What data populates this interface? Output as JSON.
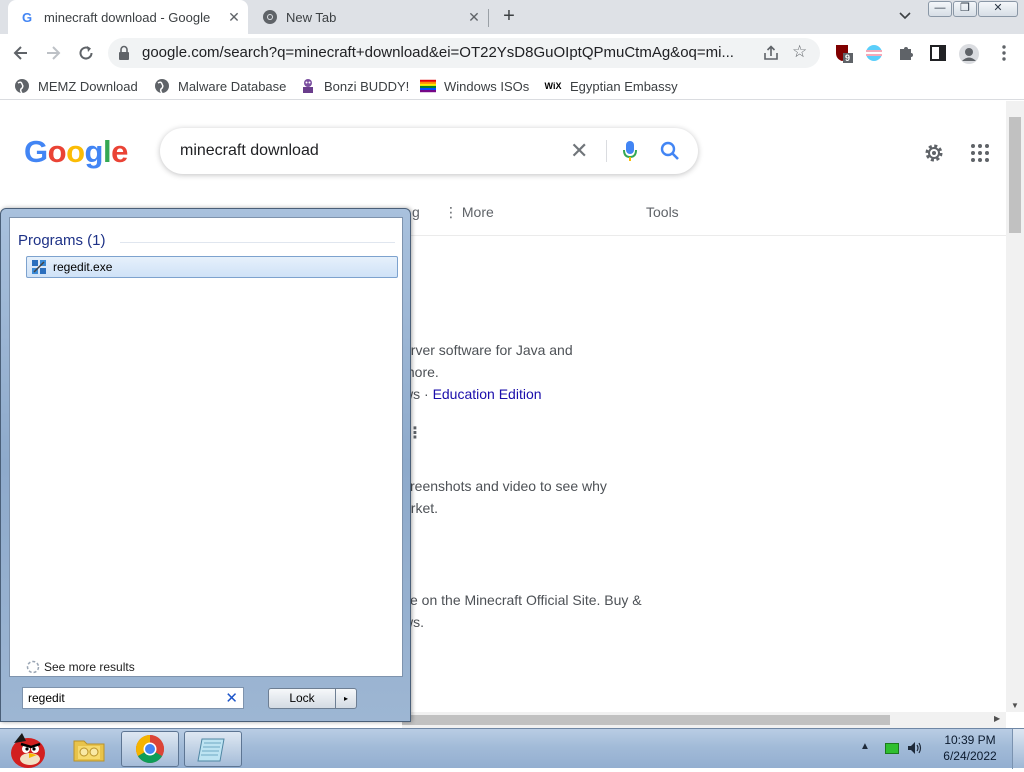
{
  "browser": {
    "tabs": [
      {
        "title": "minecraft download - Google",
        "active": true
      },
      {
        "title": "New Tab",
        "active": false
      }
    ],
    "new_tab_label": "+",
    "url": "google.com/search?q=minecraft+download&ei=OT22YsD8GuOIptQPmuCtmAg&oq=mi...",
    "extension_badge": "9",
    "bookmarks": [
      {
        "label": "MEMZ Download",
        "icon": "globe-icon"
      },
      {
        "label": "Malware Database",
        "icon": "globe-icon"
      },
      {
        "label": "Bonzi BUDDY!",
        "icon": "bonzi-icon"
      },
      {
        "label": "Windows ISOs",
        "icon": "rainbow-flag-icon"
      },
      {
        "label": "Egyptian Embassy",
        "icon": "wix-icon"
      }
    ],
    "wix_mark": "WiX"
  },
  "google": {
    "logo": [
      "G",
      "o",
      "o",
      "g",
      "l",
      "e"
    ],
    "logo_colors": [
      "#4285f4",
      "#ea4335",
      "#fbbc05",
      "#4285f4",
      "#34a853",
      "#ea4335"
    ],
    "query": "minecraft download",
    "tabs": {
      "more": "More",
      "partial": "g",
      "tools": "Tools"
    },
    "results": [
      "erver software for Java and",
      "more.",
      "ws · ",
      "Education Edition",
      "creenshots and video to see why",
      "arket.",
      "se on the Minecraft Official Site. Buy &",
      "ws."
    ]
  },
  "start_menu": {
    "section_header": "Programs (1)",
    "program": "regedit.exe",
    "see_more": "See more results",
    "search_value": "regedit",
    "lock_label": "Lock",
    "lock_arrow": "▸"
  },
  "taskbar": {
    "time": "10:39 PM",
    "date": "6/24/2022"
  },
  "colors": {
    "accent": "#1a73e8",
    "link": "#1a0dab",
    "taskbar": "#a2bbd8"
  }
}
